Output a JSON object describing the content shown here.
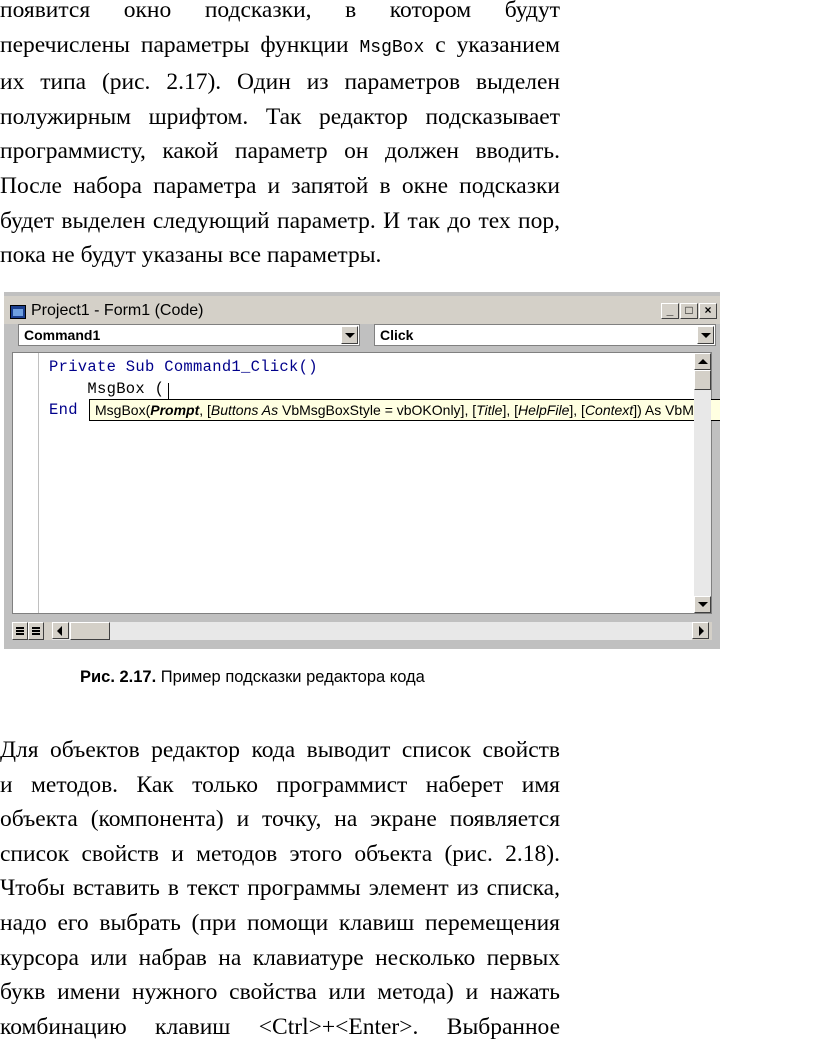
{
  "paragraph1": {
    "lines": [
      [
        "появится окно подсказки, в котором будут"
      ],
      [
        "перечислены параметры функции ",
        "MsgBox",
        " с указанием"
      ],
      [
        "их типа (рис. 2.17). Один из параметров выделен"
      ],
      [
        "полужирным шрифтом. Так редактор подсказывает"
      ],
      [
        "программисту, какой параметр он должен вводить."
      ],
      [
        "После набора параметра и запятой в окне подсказки"
      ],
      [
        "будет выделен следующий параметр. И так до тех пор,"
      ],
      [
        "пока не будут указаны все параметры."
      ]
    ]
  },
  "ide": {
    "title": "Project1 - Form1 (Code)",
    "object_combo": "Command1",
    "procedure_combo": "Click",
    "code_lines": [
      "Private Sub Command1_Click()",
      "    MsgBox (",
      "End"
    ],
    "tooltip": {
      "prefix": "MsgBox(",
      "bold_param": "Prompt",
      "rest_parts": [
        ", [",
        "Buttons As",
        " VbMsgBoxStyle = vbOKOnly], [",
        "Title",
        "], [",
        "HelpFile",
        "], [",
        "Context",
        "]) As VbM"
      ]
    },
    "icons": [
      "window-icon",
      "minimize-icon",
      "maximize-icon",
      "close-icon",
      "dropdown-arrow-icon",
      "scroll-up-icon",
      "scroll-down-icon",
      "scroll-left-icon",
      "scroll-right-icon",
      "procedure-view-icon",
      "full-module-view-icon"
    ]
  },
  "caption": {
    "number": "Рис. 2.17.",
    "text": " Пример подсказки редактора кода"
  },
  "paragraph2": {
    "lines": [
      "Для объектов редактор кода выводит список свойств",
      "и методов. Как только программист наберет имя",
      "объекта (компонента) и точку, на экране появляется",
      "список свойств и методов этого объекта (рис. 2.18).",
      "Чтобы вставить в текст программы элемент из списка,",
      "надо его выбрать (при помощи клавиш перемещения",
      "курсора или набрав на клавиатуре несколько первых",
      "букв имени нужного свойства или метода) и нажать",
      "комбинацию клавиш <Ctrl>+<Enter>. Выбранное"
    ]
  }
}
